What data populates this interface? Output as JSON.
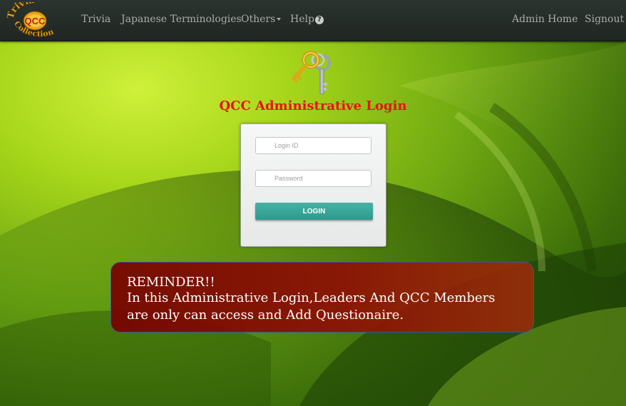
{
  "nav": {
    "logo_text_qcc": "QCC",
    "logo_text_trivia": "Trivia",
    "logo_text_collection": "Collection",
    "links": {
      "trivia": "Trivia",
      "japanese": "Japanese Terminologies",
      "others": "Others",
      "help": "Help",
      "admin_home": "Admin Home",
      "signout": "Signout"
    },
    "help_icon_glyph": "?"
  },
  "login": {
    "title": "QCC Administrative Login",
    "login_id_placeholder": "Login ID",
    "password_placeholder": "Password",
    "button_label": "LOGIN"
  },
  "reminder": {
    "heading": "REMINDER!!",
    "body": "In this Administrative Login,Leaders And QCC Members are only can access and Add Questionaire."
  },
  "colors": {
    "title_red": "#ee1010",
    "button_teal": "#3aa79b",
    "navbar_bg": "#262d29",
    "reminder_bg": "#8c0a05"
  },
  "icons": {
    "keys": "keys-icon",
    "help": "question-circle-icon",
    "dropdown": "caret-down-icon"
  }
}
